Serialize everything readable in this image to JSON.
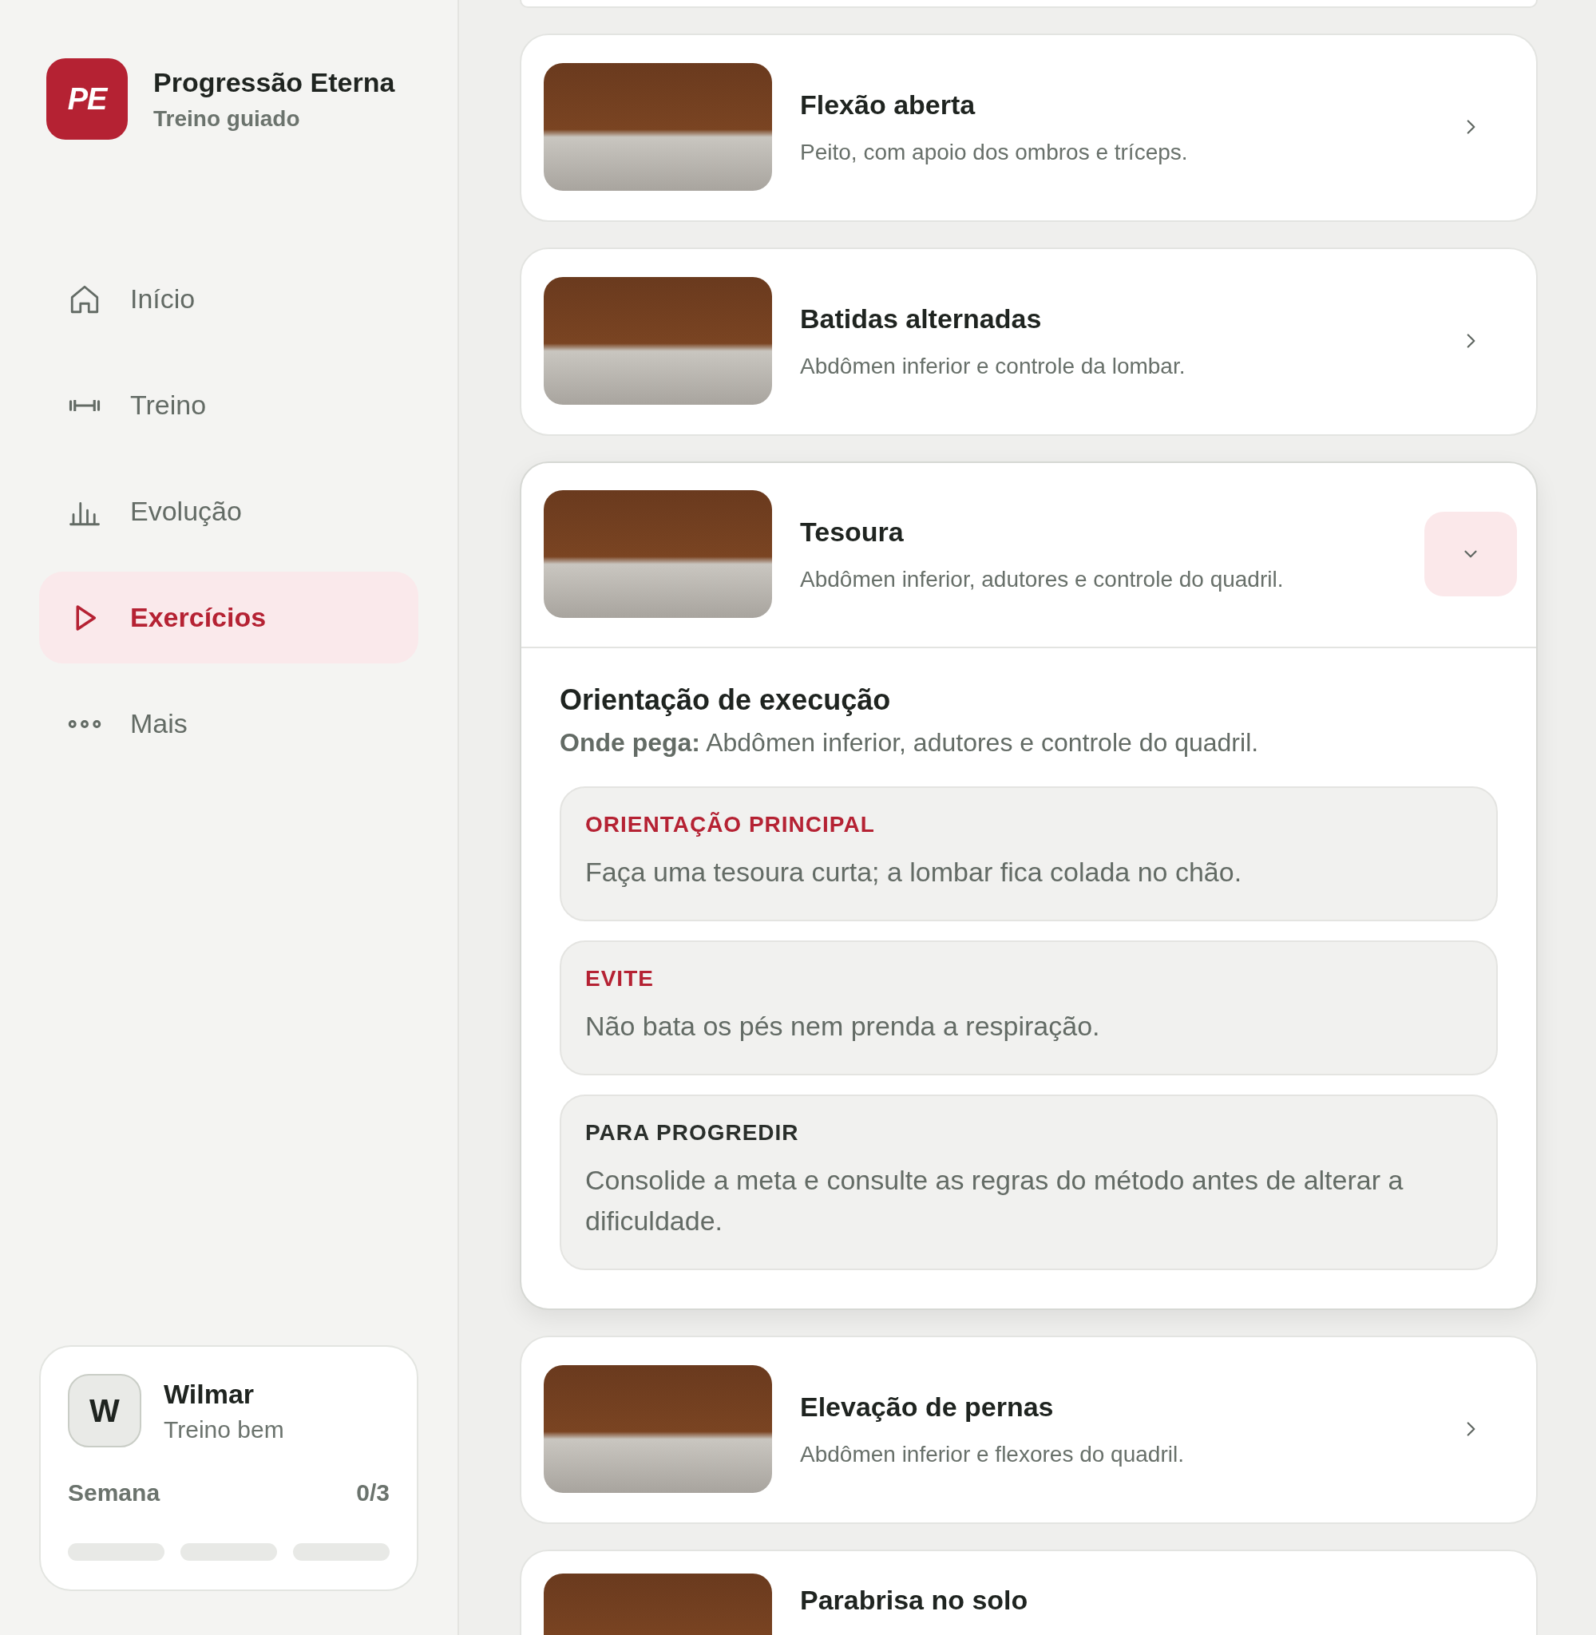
{
  "app": {
    "logo": "PE",
    "name": "Progressão Eterna",
    "subtitle": "Treino guiado"
  },
  "nav": [
    {
      "label": "Início",
      "selected": false
    },
    {
      "label": "Treino",
      "selected": false
    },
    {
      "label": "Evolução",
      "selected": false
    },
    {
      "label": "Exercícios",
      "selected": true
    },
    {
      "label": "Mais",
      "selected": false
    }
  ],
  "user": {
    "initial": "W",
    "name": "Wilmar",
    "status": "Treino bem",
    "week_label": "Semana",
    "week_count": "0/3",
    "progress": [
      {
        "level": 0
      },
      {
        "level": 0
      },
      {
        "level": 0
      }
    ]
  },
  "exercises": [
    {
      "title": "Flexão aberta",
      "description": "Peito, com apoio dos ombros e tríceps.",
      "expanded": false
    },
    {
      "title": "Batidas alternadas",
      "description": "Abdômen inferior e controle da lombar.",
      "expanded": false
    },
    {
      "title": "Tesoura",
      "description": "Abdômen inferior, adutores e controle do quadril.",
      "expanded": true,
      "details": {
        "heading": "Orientação de execução",
        "where": "**Onde pega:** Abdômen inferior, adutores e controle do quadril.",
        "notes": [
          {
            "kind": "main",
            "label": "ORIENTAÇÃO PRINCIPAL",
            "text": "Faça uma tesoura curta; a lombar fica colada no chão."
          },
          {
            "kind": "avoid",
            "label": "EVITE",
            "text": "Não bata os pés nem prenda a respiração."
          },
          {
            "kind": "progress",
            "label": "PARA PROGREDIR",
            "text": "Consolide a meta e consulte as regras do método antes de alterar a dificuldade."
          }
        ]
      }
    },
    {
      "title": "Elevação de pernas",
      "description": "Abdômen inferior e flexores do quadril.",
      "expanded": false
    },
    {
      "title": "Parabrisa no solo",
      "expanded": false
    }
  ]
}
